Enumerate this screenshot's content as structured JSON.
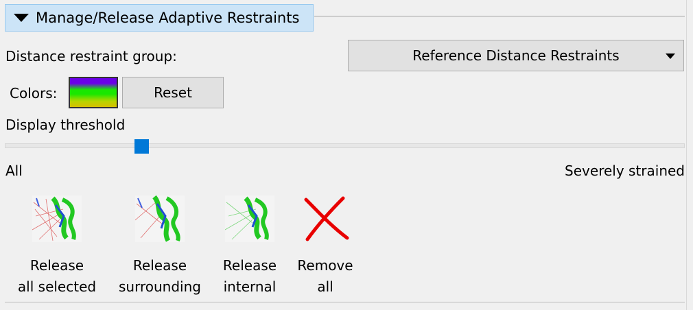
{
  "section": {
    "title": "Manage/Release Adaptive Restraints"
  },
  "group": {
    "label": "Distance restraint group:",
    "selected": "Reference Distance Restraints"
  },
  "colors": {
    "label": "Colors:",
    "reset_label": "Reset",
    "gradient": [
      "#6a00e8",
      "#19e800",
      "#d6c000"
    ]
  },
  "threshold": {
    "label": "Display threshold",
    "value_fraction": 0.195,
    "min_label": "All",
    "max_label": "Severely strained"
  },
  "tools": [
    {
      "line1": "Release",
      "line2": "all selected",
      "icon": "release-all-selected-icon"
    },
    {
      "line1": "Release",
      "line2": "surrounding",
      "icon": "release-surrounding-icon"
    },
    {
      "line1": "Release",
      "line2": "internal",
      "icon": "release-internal-icon"
    },
    {
      "line1": "Remove",
      "line2": "all",
      "icon": "remove-all-icon"
    }
  ]
}
